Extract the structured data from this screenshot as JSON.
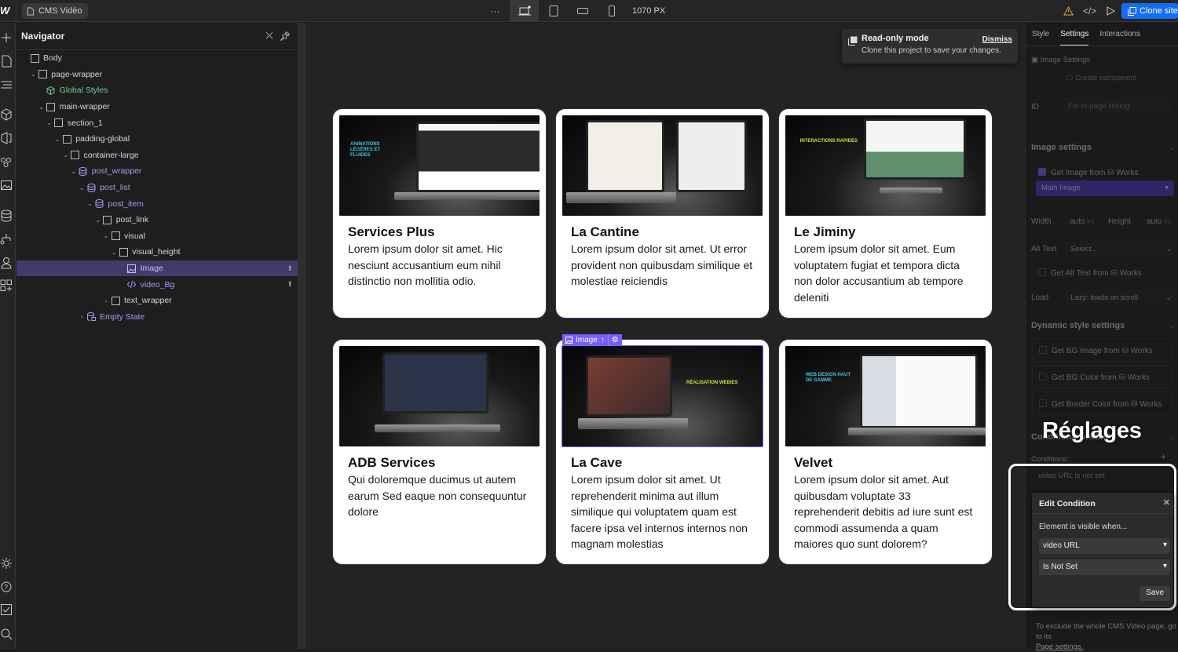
{
  "topbar": {
    "page_name": "CMS Vidéo",
    "more_label": "···",
    "breakpoint_width": "1070 PX",
    "clone_label": "Clone site",
    "icons": [
      "webflow-logo",
      "page-icon",
      "desktop-breakpoint-icon",
      "tablet-icon",
      "mobile-landscape-icon",
      "mobile-portrait-icon",
      "warning-icon",
      "code-icon",
      "preview-play-icon",
      "clone-icon"
    ]
  },
  "navigator": {
    "title": "Navigator",
    "tree": [
      {
        "label": "Body",
        "depth": 0,
        "caret": "",
        "type": "box"
      },
      {
        "label": "page-wrapper",
        "depth": 1,
        "caret": "v",
        "type": "box"
      },
      {
        "label": "Global Styles",
        "depth": 2,
        "caret": "",
        "type": "component"
      },
      {
        "label": "main-wrapper",
        "depth": 2,
        "caret": "v",
        "type": "box"
      },
      {
        "label": "section_1",
        "depth": 3,
        "caret": "v",
        "type": "box"
      },
      {
        "label": "padding-global",
        "depth": 4,
        "caret": "v",
        "type": "box"
      },
      {
        "label": "container-large",
        "depth": 5,
        "caret": "v",
        "type": "box"
      },
      {
        "label": "post_wrapper",
        "depth": 6,
        "caret": "v",
        "type": "cms"
      },
      {
        "label": "post_list",
        "depth": 7,
        "caret": "v",
        "type": "cms"
      },
      {
        "label": "post_item",
        "depth": 8,
        "caret": "v",
        "type": "cms"
      },
      {
        "label": "post_link",
        "depth": 9,
        "caret": "v",
        "type": "box"
      },
      {
        "label": "visual",
        "depth": 10,
        "caret": "v",
        "type": "box"
      },
      {
        "label": "visual_height",
        "depth": 11,
        "caret": "v",
        "type": "box"
      },
      {
        "label": "Image",
        "depth": 12,
        "caret": "",
        "type": "image",
        "selected": true
      },
      {
        "label": "video_Bg",
        "depth": 12,
        "caret": "",
        "type": "code"
      },
      {
        "label": "text_wrapper",
        "depth": 10,
        "caret": ">",
        "type": "box"
      },
      {
        "label": "Empty State",
        "depth": 7,
        "caret": ">",
        "type": "empty"
      }
    ]
  },
  "toast": {
    "title": "Read-only mode",
    "message": "Clone this project to save your changes.",
    "dismiss_label": "Dismiss"
  },
  "canvas": {
    "selected_badge": "Image",
    "cards": [
      {
        "title": "Services Plus",
        "desc": "Lorem ipsum dolor sit amet. Hic nesciunt accusantium eum nihil distinctio non mollitia odio.",
        "thumb_caption": "ANIMATIONS LÉGÈRES ET FLUIDES",
        "caption_color": "#3fc4d8"
      },
      {
        "title": "La Cantine",
        "desc": "Lorem ipsum dolor sit amet. Ut error provident non quibusdam similique et molestiae reiciendis",
        "thumb_caption": "",
        "caption_color": "#ffffff"
      },
      {
        "title": "Le Jiminy",
        "desc": "Lorem ipsum dolor sit amet. Eum voluptatem fugiat et tempora dicta non dolor accusantium ab tempore deleniti",
        "thumb_caption": "INTERACTIONS RAPIDES",
        "caption_color": "#c5e03a"
      },
      {
        "title": "ADB Services",
        "desc": "Qui doloremque ducimus ut autem earum Sed eaque non consequuntur dolore",
        "thumb_caption": "",
        "caption_color": "#ffffff"
      },
      {
        "title": "La Cave",
        "desc": "Lorem ipsum dolor sit amet. Ut reprehenderit minima aut illum similique qui voluptatem quam est facere ipsa vel internos internos non magnam molestias",
        "thumb_caption": "RÉALISATION WEBIES",
        "caption_color": "#c5e03a"
      },
      {
        "title": "Velvet",
        "desc": "Lorem ipsum dolor sit amet. Aut quibusdam voluptate 33 reprehenderit debitis ad iure sunt est commodi assumenda a quam maiores quo sunt dolorem?",
        "thumb_caption": "WEB DESIGN HAUT DE GAMME",
        "caption_color": "#3fc4d8"
      }
    ]
  },
  "settings_panel": {
    "tabs": [
      "Style",
      "Settings",
      "Interactions"
    ],
    "active_tab": "Settings",
    "element_label": "Image Settings",
    "create_component": "Create component",
    "id_label": "ID",
    "id_placeholder": "For in-page linking",
    "image_settings": {
      "title": "Image settings",
      "get_image_from": "Get Image from",
      "collection": "Works",
      "get_image_checked": true,
      "field": "Main Image",
      "width_label": "Width",
      "width_value": "auto",
      "height_label": "Height",
      "height_value": "auto",
      "unit": "PX",
      "alt_label": "Alt Text",
      "alt_placeholder": "Select...",
      "get_alt_from": "Get Alt Text from",
      "load_label": "Load",
      "load_value": "Lazy: loads on scroll"
    },
    "dynamic_style": {
      "title": "Dynamic style settings",
      "items": [
        "Get BG Image from",
        "Get BG Color from",
        "Get Border Color from"
      ],
      "collection": "Works"
    },
    "conditional": {
      "title": "Conditional visibility",
      "conditions_label": "Conditions:",
      "existing_condition": "video URL is not set",
      "footnote_text": "To exclude the whole CMS Vidéo page, go to its",
      "footnote_link": "Page settings."
    },
    "overlay_title": "Réglages"
  },
  "edit_condition": {
    "title": "Edit Condition",
    "label": "Element is visible when...",
    "field": "video URL",
    "operator": "Is Not Set",
    "save_label": "Save"
  }
}
